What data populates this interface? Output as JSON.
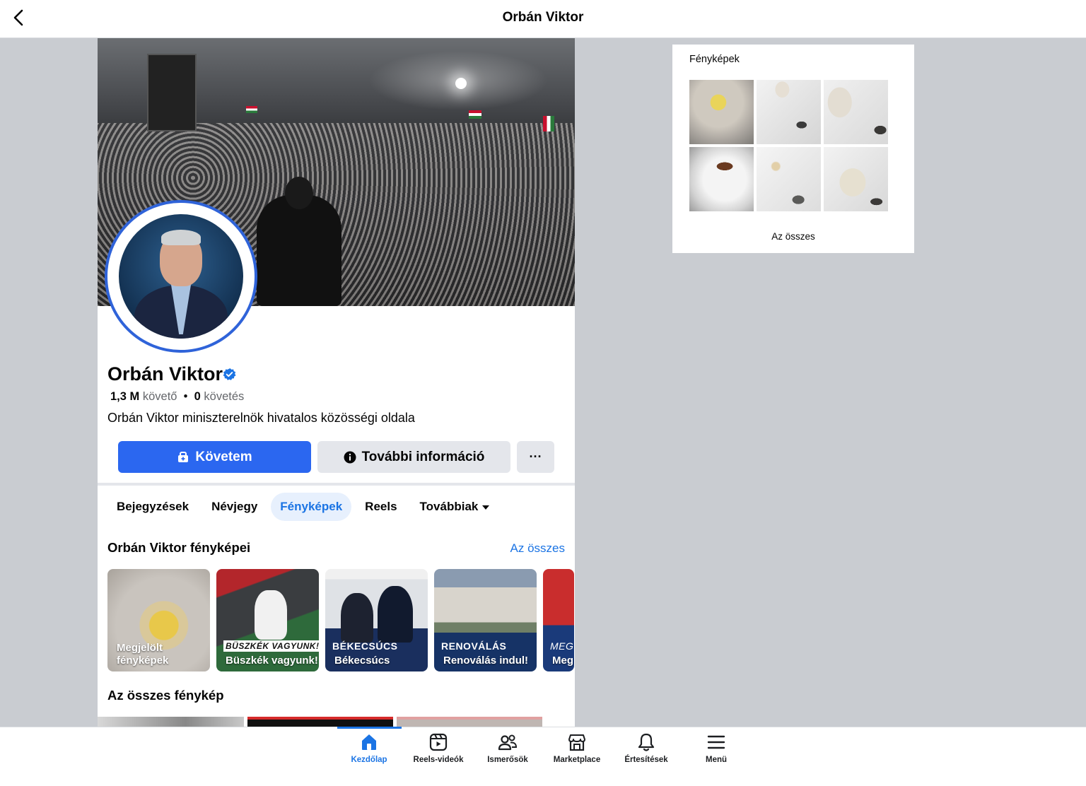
{
  "topbar": {
    "title": "Orbán Viktor"
  },
  "profile": {
    "name": "Orbán Viktor",
    "followers_value": "1,3 M",
    "followers_label": "követő",
    "separator": "•",
    "following_value": "0",
    "following_label": "követés",
    "bio": "Orbán Viktor miniszterelnök hivatalos közösségi oldala"
  },
  "actions": {
    "follow": "Követem",
    "info": "További információ",
    "more": "···"
  },
  "tabs": [
    "Bejegyzések",
    "Névjegy",
    "Fényképek",
    "Reels",
    "Továbbiak"
  ],
  "active_tab": "Fényképek",
  "albums_section": {
    "title": "Orbán Viktor fényképei",
    "see_all": "Az összes",
    "albums": [
      {
        "overline": "",
        "label_line1": "Megjelölt",
        "label_line2": "fényképek"
      },
      {
        "overline": "BÜSZKÉK VAGYUNK!",
        "label_line1": "Büszkék vagyunk!",
        "label_line2": ""
      },
      {
        "overline": "BÉKECSÚCS",
        "label_line1": "Békecsúcs",
        "label_line2": ""
      },
      {
        "overline": "RENOVÁLÁS",
        "label_line1": "Renoválás indul!",
        "label_line2": ""
      },
      {
        "overline": "MEG",
        "label_line1": "Meg",
        "label_line2": ""
      }
    ]
  },
  "all_photos_section": {
    "title": "Az összes fénykép"
  },
  "photos_widget": {
    "title": "Fényképek",
    "see_all": "Az összes"
  },
  "bottom_nav": [
    {
      "label": "Kezdőlap",
      "icon": "home-icon",
      "active": true
    },
    {
      "label": "Reels-videók",
      "icon": "reels-icon",
      "active": false
    },
    {
      "label": "Ismerősök",
      "icon": "friends-icon",
      "active": false
    },
    {
      "label": "Marketplace",
      "icon": "marketplace-icon",
      "active": false
    },
    {
      "label": "Értesítések",
      "icon": "bell-icon",
      "active": false
    },
    {
      "label": "Menü",
      "icon": "menu-icon",
      "active": false
    }
  ],
  "colors": {
    "accent": "#1b74e4",
    "follow_button": "#2b67f0",
    "backdrop": "#c9ccd1",
    "secondary_button": "#e4e6eb"
  }
}
